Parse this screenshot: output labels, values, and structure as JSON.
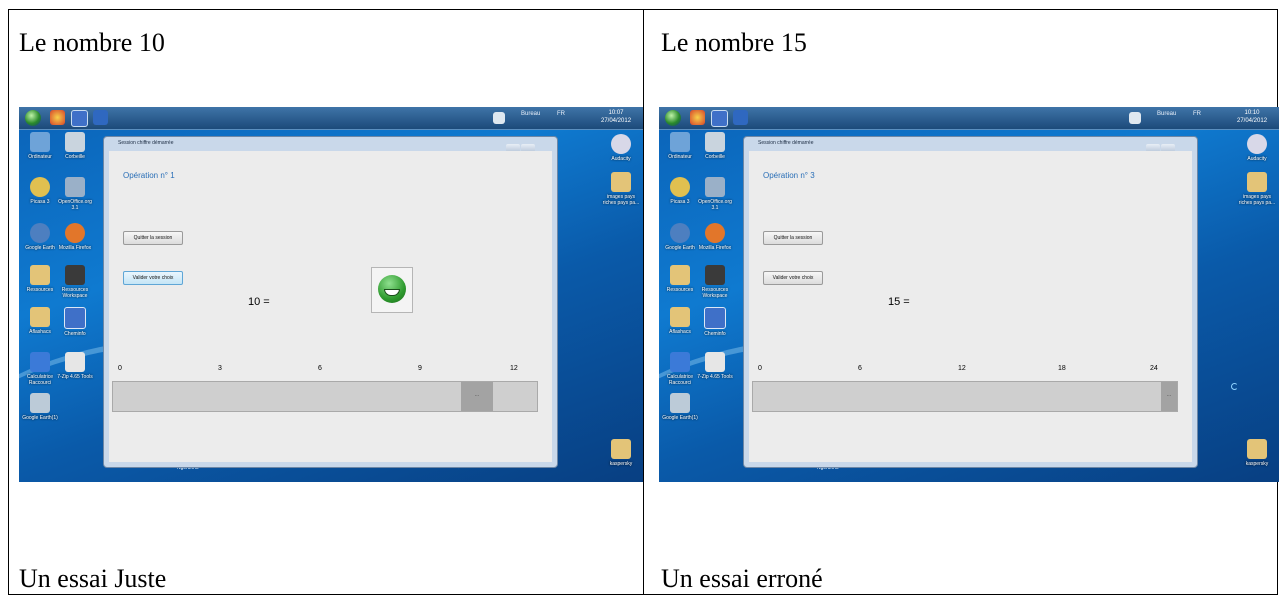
{
  "left": {
    "title": "Le nombre 10",
    "caption": "Un essai Juste",
    "screenshot": {
      "window_title": "Session chiffre démarrée",
      "operation": "Opération n° 1",
      "quit_button": "Quitter la session",
      "validate_button": "Valider votre choix",
      "equation": "10 =",
      "slider_ticks": [
        "0",
        "3",
        "6",
        "9",
        "12"
      ],
      "slider_value": 10.3,
      "slider_range": [
        0,
        12
      ],
      "slider_thumb_label": "...",
      "feedback_icon": "smiley-green-icon",
      "clock_time": "10:07",
      "clock_date": "27/04/2012"
    }
  },
  "right": {
    "title": "Le nombre 15",
    "caption": "Un essai erroné",
    "screenshot": {
      "window_title": "Session chiffre démarrée",
      "operation": "Opération n° 3",
      "quit_button": "Quitter la session",
      "validate_button": "Valider votre choix",
      "equation": "15 =",
      "slider_ticks": [
        "0",
        "6",
        "12",
        "18",
        "24"
      ],
      "slider_value": 24,
      "slider_range": [
        0,
        24
      ],
      "slider_thumb_label": "...",
      "clock_time": "10:10",
      "clock_date": "27/04/2012"
    }
  },
  "taskbar": {
    "desktop_label": "Bureau",
    "lang": "FR"
  },
  "desktop_icons": [
    {
      "label": "Ordinateur",
      "color": "#6ea3d8"
    },
    {
      "label": "Corbeille",
      "color": "#c9d4de"
    },
    {
      "label": "Picasa 3",
      "color": "#e0c050"
    },
    {
      "label": "OpenOffice.org 3.1",
      "color": "#9ab0c8"
    },
    {
      "label": "Google Earth",
      "color": "#4d7fc0"
    },
    {
      "label": "Mozilla Firefox",
      "color": "#e2762a"
    },
    {
      "label": "Ressources",
      "color": "#e3c478"
    },
    {
      "label": "Ressources Workspace",
      "color": "#3a3a3a"
    },
    {
      "label": "Aflashacs",
      "color": "#e3c478"
    },
    {
      "label": "Cheminfo",
      "color": "#3f70c8"
    },
    {
      "label": "Calculatrice Raccourci",
      "color": "#3b7ad8"
    },
    {
      "label": "7-Zip 4.65 Tools",
      "color": "#e6e6e6"
    },
    {
      "label": "Google Earth(1)",
      "color": "#bccbd8"
    }
  ],
  "right_desktop_icons": [
    {
      "label": "Audacity",
      "color": "#d8d8e8"
    },
    {
      "label": "images pays riches pays pa...",
      "color": "#e3c478"
    },
    {
      "label": "kaspersky",
      "color": "#e3c478"
    }
  ],
  "recycle_label": "Ngertinho"
}
